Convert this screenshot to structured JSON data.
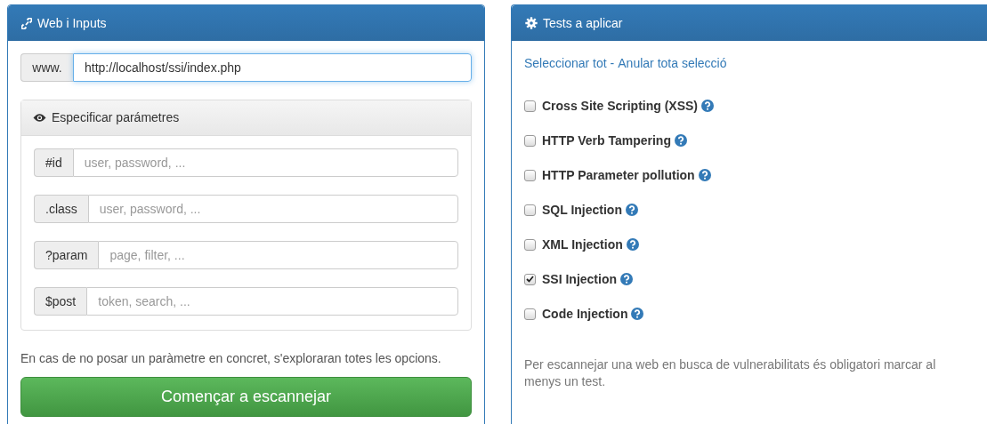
{
  "inputs_panel": {
    "title": "Web i Inputs",
    "url": {
      "prefix": "www.",
      "value": "http://localhost/ssi/index.php"
    },
    "params_panel": {
      "title": "Especificar parámetres",
      "fields": [
        {
          "prefix": "#id",
          "placeholder": "user, password, ..."
        },
        {
          "prefix": ".class",
          "placeholder": "user, password, ..."
        },
        {
          "prefix": "?param",
          "placeholder": "page, filter, ..."
        },
        {
          "prefix": "$post",
          "placeholder": "token, search, ..."
        }
      ]
    },
    "help": "En cas de no posar un paràmetre en concret, s'exploraran totes les opcions.",
    "button": "Començar a escannejar"
  },
  "tests_panel": {
    "title": "Tests a aplicar",
    "select_all": "Seleccionar tot",
    "separator": "-",
    "deselect_all": "Anular tota selecció",
    "tests": [
      {
        "label": "Cross Site Scripting (XSS)",
        "checked": false
      },
      {
        "label": "HTTP Verb Tampering",
        "checked": false
      },
      {
        "label": "HTTP Parameter pollution",
        "checked": false
      },
      {
        "label": "SQL Injection",
        "checked": false
      },
      {
        "label": "XML Injection",
        "checked": false
      },
      {
        "label": "SSI Injection",
        "checked": true
      },
      {
        "label": "Code Injection",
        "checked": false
      }
    ],
    "help": "Per escannejar una web en busca de vulnerabilitats és obligatori marcar al menys un test."
  }
}
